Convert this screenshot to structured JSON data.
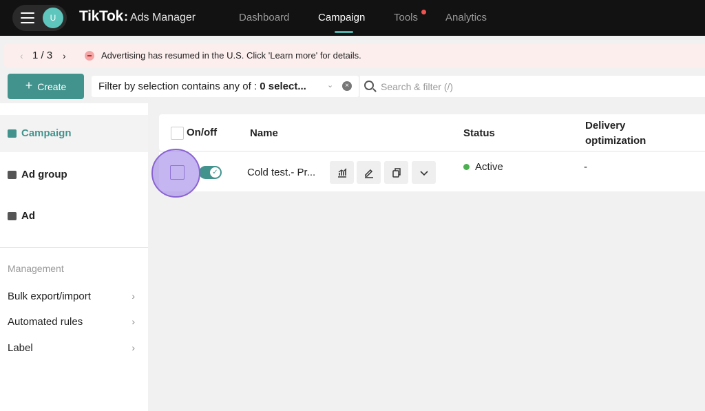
{
  "header": {
    "avatar_initial": "U",
    "brand_main": "TikTok",
    "brand_colon": ":",
    "brand_sub": "Ads Manager",
    "nav": [
      "Dashboard",
      "Campaign",
      "Tools",
      "Analytics"
    ],
    "active_nav": "Campaign"
  },
  "notice": {
    "counter": "1 / 3",
    "prev_glyph": "‹",
    "next_glyph": "›",
    "text": "Advertising has resumed in the U.S. Click 'Learn more' for details."
  },
  "toolbar": {
    "create_plus": "+",
    "create_label": "Create",
    "filter_prefix": "Filter by selection contains any of : ",
    "filter_value": "0 select...",
    "filter_clear": "×",
    "filter_chevron": "⌄",
    "search_placeholder": "Search & filter (/)"
  },
  "sidebar": {
    "levels": [
      "Campaign",
      "Ad group",
      "Ad"
    ],
    "active_level": "Campaign",
    "section_title": "Management",
    "links": [
      "Bulk export/import",
      "Automated rules",
      "Label"
    ],
    "link_chevron": "›"
  },
  "table": {
    "columns": {
      "onoff": "On/off",
      "name": "Name",
      "status": "Status",
      "delivery_line1": "Delivery",
      "delivery_line2": "optimization"
    },
    "rows": [
      {
        "name": "Cold test.- Pr...",
        "toggle_on": true,
        "toggle_glyph": "✓",
        "status": "Active",
        "delivery": "-"
      }
    ]
  },
  "colors": {
    "accent": "#42938d",
    "topbar": "#121212",
    "status_active": "#4caf50",
    "highlight": "#8a63d2"
  }
}
